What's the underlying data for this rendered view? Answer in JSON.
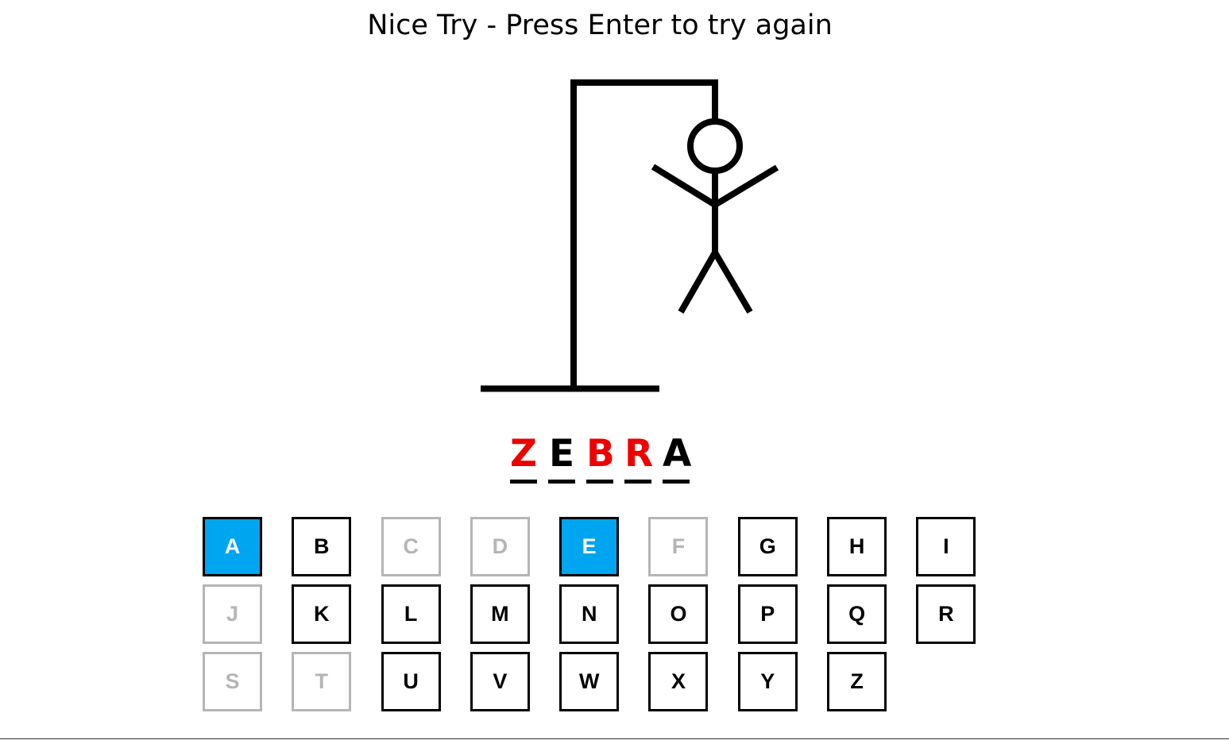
{
  "status_message": "Nice Try - Press Enter to try again",
  "word": [
    {
      "letter": "Z",
      "state": "missed"
    },
    {
      "letter": "E",
      "state": "found"
    },
    {
      "letter": "B",
      "state": "missed"
    },
    {
      "letter": "R",
      "state": "missed"
    },
    {
      "letter": "A",
      "state": "found"
    }
  ],
  "keys": [
    {
      "letter": "A",
      "state": "used-hit"
    },
    {
      "letter": "B",
      "state": "unused"
    },
    {
      "letter": "C",
      "state": "used-miss"
    },
    {
      "letter": "D",
      "state": "used-miss"
    },
    {
      "letter": "E",
      "state": "used-hit"
    },
    {
      "letter": "F",
      "state": "used-miss"
    },
    {
      "letter": "G",
      "state": "unused"
    },
    {
      "letter": "H",
      "state": "unused"
    },
    {
      "letter": "I",
      "state": "unused"
    },
    {
      "letter": "J",
      "state": "used-miss"
    },
    {
      "letter": "K",
      "state": "unused"
    },
    {
      "letter": "L",
      "state": "unused"
    },
    {
      "letter": "M",
      "state": "unused"
    },
    {
      "letter": "N",
      "state": "unused"
    },
    {
      "letter": "O",
      "state": "unused"
    },
    {
      "letter": "P",
      "state": "unused"
    },
    {
      "letter": "Q",
      "state": "unused"
    },
    {
      "letter": "R",
      "state": "unused"
    },
    {
      "letter": "S",
      "state": "used-miss"
    },
    {
      "letter": "T",
      "state": "used-miss"
    },
    {
      "letter": "U",
      "state": "unused"
    },
    {
      "letter": "V",
      "state": "unused"
    },
    {
      "letter": "W",
      "state": "unused"
    },
    {
      "letter": "X",
      "state": "unused"
    },
    {
      "letter": "Y",
      "state": "unused"
    },
    {
      "letter": "Z",
      "state": "unused"
    }
  ],
  "colors": {
    "missed_letter": "#ee0000",
    "found_letter": "#000000",
    "key_hit_bg": "#00a5f0",
    "key_miss_border": "#b5b5b5"
  },
  "drawing": {
    "parts_shown": [
      "base",
      "pole",
      "beam",
      "rope",
      "head",
      "body",
      "left-arm",
      "right-arm",
      "left-leg",
      "right-leg"
    ]
  }
}
